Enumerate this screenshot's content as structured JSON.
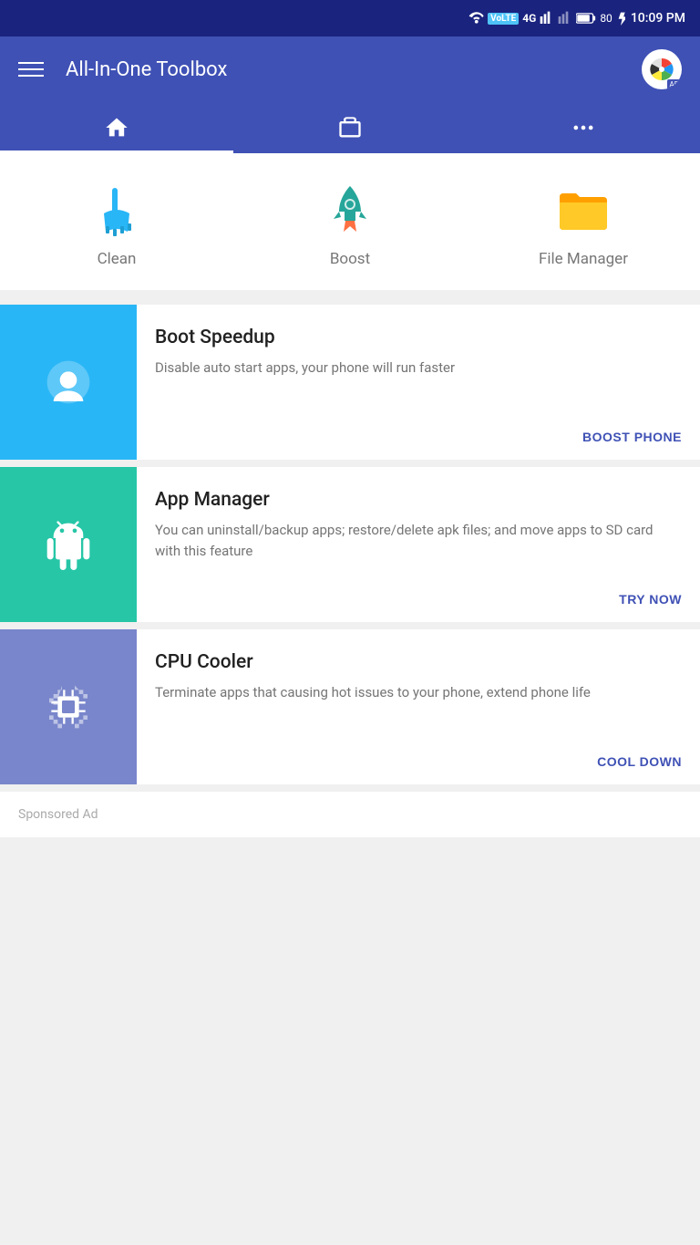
{
  "statusBar": {
    "time": "10:09 PM",
    "icons": [
      "wifi-calling",
      "volte",
      "4g",
      "signal",
      "signal-r",
      "battery-80",
      "charging"
    ]
  },
  "header": {
    "title": "All-In-One Toolbox",
    "adLabel": "AD"
  },
  "navTabs": [
    {
      "id": "home",
      "label": "Home",
      "active": true
    },
    {
      "id": "tools",
      "label": "Tools",
      "active": false
    },
    {
      "id": "more",
      "label": "More",
      "active": false
    }
  ],
  "quickActions": [
    {
      "id": "clean",
      "label": "Clean",
      "iconColor": "#29b6f6"
    },
    {
      "id": "boost",
      "label": "Boost",
      "iconColor": "#26a69a"
    },
    {
      "id": "file-manager",
      "label": "File Manager",
      "iconColor": "#ffa000"
    }
  ],
  "featureCards": [
    {
      "id": "boot-speedup",
      "title": "Boot Speedup",
      "description": "Disable auto start apps, your phone will run faster",
      "actionLabel": "BOOST PHONE",
      "iconBg": "bg-blue"
    },
    {
      "id": "app-manager",
      "title": "App Manager",
      "description": "You can uninstall/backup apps; restore/delete apk files; and move apps to SD card with this feature",
      "actionLabel": "TRY NOW",
      "iconBg": "bg-teal"
    },
    {
      "id": "cpu-cooler",
      "title": "CPU Cooler",
      "description": "Terminate apps that causing hot issues to your phone, extend phone life",
      "actionLabel": "COOL DOWN",
      "iconBg": "bg-purple"
    }
  ],
  "sponsoredAd": {
    "label": "Sponsored Ad"
  }
}
